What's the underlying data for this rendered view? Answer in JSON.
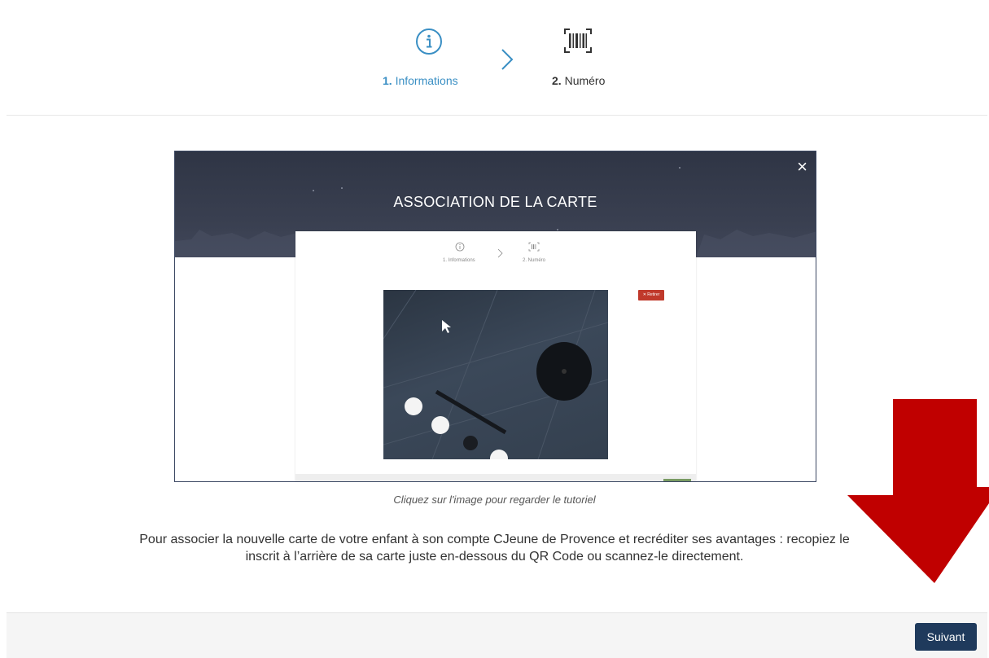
{
  "stepper": {
    "steps": [
      {
        "number": "1.",
        "label": "Informations",
        "icon": "info-circle-icon",
        "active": true
      },
      {
        "number": "2.",
        "label": "Numéro",
        "icon": "barcode-icon",
        "active": false
      }
    ],
    "separator_icon": "chevron-right-icon"
  },
  "video": {
    "title": "ASSOCIATION DE LA CARTE",
    "close_label": "×",
    "inner_steps": [
      {
        "label": "1. Informations"
      },
      {
        "label": "2. Numéro"
      }
    ],
    "remove_button_label": "✕ Retirer",
    "caption": "Cliquez sur l'image pour regarder le tutoriel"
  },
  "description": {
    "line1": "Pour associer la nouvelle carte de votre enfant à son compte CJeune de Provence et recréditer ses avantages : recopiez le",
    "line2": "inscrit à l’arrière de sa carte juste en-dessous du QR Code ou scannez-le directement."
  },
  "footer": {
    "next_label": "Suivant"
  },
  "colors": {
    "accent": "#3a8fc4",
    "button": "#1f3a5c",
    "annotation_arrow": "#c00000"
  }
}
